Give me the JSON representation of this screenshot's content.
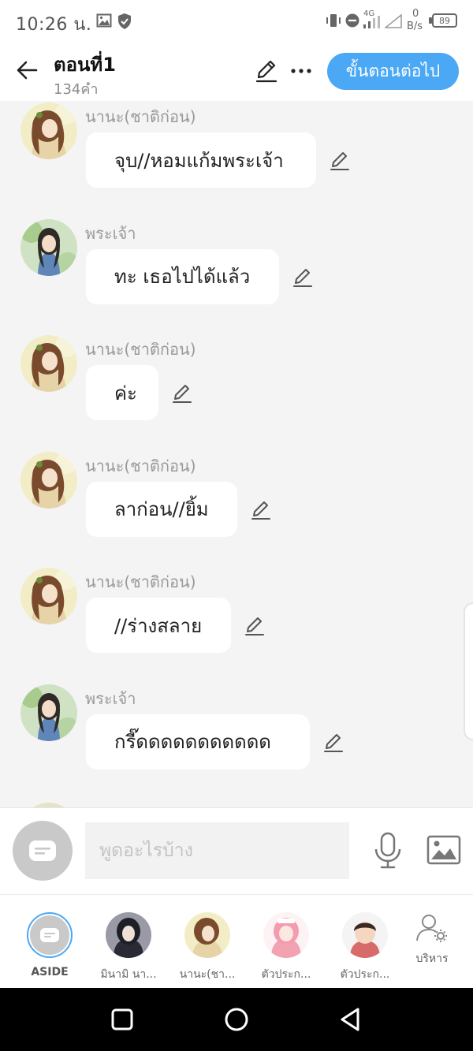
{
  "status_bar": {
    "time": "10:26 น.",
    "network_label": "4G",
    "data_speed_value": "0",
    "data_speed_unit": "B/s",
    "battery": "89"
  },
  "header": {
    "title": "ตอนที่1",
    "word_count": "134คำ",
    "next_button": "ขั้นตอนต่อไป"
  },
  "messages": [
    {
      "speaker": "นานะ(ชาติก่อน)",
      "text": "จุบ//หอมแก้มพระเจ้า",
      "avatar": "nana"
    },
    {
      "speaker": "พระเจ้า",
      "text": "ทะ เธอไปได้แล้ว",
      "avatar": "god"
    },
    {
      "speaker": "นานะ(ชาติก่อน)",
      "text": "ค่ะ",
      "avatar": "nana"
    },
    {
      "speaker": "นานะ(ชาติก่อน)",
      "text": "ลาก่อน//ยิ้ม",
      "avatar": "nana"
    },
    {
      "speaker": "นานะ(ชาติก่อน)",
      "text": "//ร่างสลาย",
      "avatar": "nana"
    },
    {
      "speaker": "พระเจ้า",
      "text": "กรี๊ดดดดดดดดดดด",
      "avatar": "god"
    }
  ],
  "input": {
    "placeholder": "พูดอะไรบ้าง",
    "value": ""
  },
  "characters": [
    {
      "label": "ASIDE",
      "kind": "aside"
    },
    {
      "label": "มินามิ นา...",
      "kind": "minami"
    },
    {
      "label": "นานะ(ชา...",
      "kind": "nana"
    },
    {
      "label": "ตัวประก...",
      "kind": "pink"
    },
    {
      "label": "ตัวประก...",
      "kind": "boy"
    }
  ],
  "manage_label": "บริหาร",
  "colors": {
    "accent": "#4aa8f5",
    "background": "#f4f4f4",
    "bubble": "#ffffff"
  }
}
